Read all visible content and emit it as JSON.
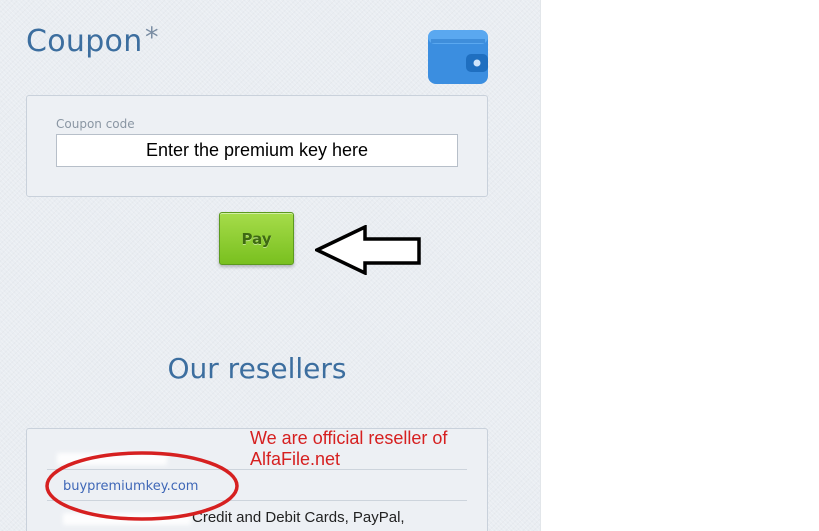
{
  "coupon": {
    "title": "Coupon",
    "required_mark": "*",
    "wallet_icon": "wallet-icon",
    "field_label": "Coupon code",
    "field_placeholder": "Enter the premium key here",
    "field_value": "",
    "pay_button": "Pay"
  },
  "annotations": {
    "arrow_icon": "left-arrow-icon",
    "circle_highlight": "red-ellipse",
    "note_line1": "We are official reseller of",
    "note_line2": "AlfaFile.net",
    "color": "#d62020"
  },
  "resellers": {
    "title": "Our resellers",
    "items": [
      {
        "link": "buypremiumkey.com",
        "payment": "Credit and Debit Cards, PayPal,"
      }
    ]
  },
  "colors": {
    "heading": "#3c6e9f",
    "link": "#3f67b7",
    "pay_button": "#8bcb2f",
    "wallet": "#3b8ee0"
  }
}
